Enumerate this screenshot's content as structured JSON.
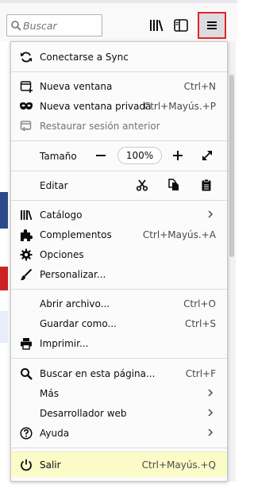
{
  "toolbar": {
    "search_placeholder": "Buscar",
    "icons": {
      "search": "search-icon",
      "library": "library-icon",
      "sidebar": "sidebar-icon",
      "menu": "hamburger-menu-icon"
    },
    "menu_button_highlight_color": "#e2242b"
  },
  "menu": {
    "sync": {
      "label": "Conectarse a Sync",
      "icon": "sync-icon"
    },
    "new_window": {
      "label": "Nueva ventana",
      "shortcut": "Ctrl+N",
      "icon": "new-window-icon"
    },
    "new_private_window": {
      "label": "Nueva ventana privada",
      "shortcut": "Ctrl+Mayús.+P",
      "icon": "private-mask-icon"
    },
    "restore_session": {
      "label": "Restaurar sesión anterior",
      "icon": "restore-session-icon"
    },
    "zoom": {
      "label": "Tamaño",
      "value": "100%"
    },
    "edit": {
      "label": "Editar",
      "icons": [
        "cut-icon",
        "copy-icon",
        "paste-icon"
      ]
    },
    "library": {
      "label": "Catálogo",
      "icon": "library-icon"
    },
    "addons": {
      "label": "Complementos",
      "shortcut": "Ctrl+Mayús.+A",
      "icon": "puzzle-icon"
    },
    "options": {
      "label": "Opciones",
      "icon": "gear-icon"
    },
    "customize": {
      "label": "Personalizar...",
      "icon": "paintbrush-icon"
    },
    "open_file": {
      "label": "Abrir archivo...",
      "shortcut": "Ctrl+O"
    },
    "save_as": {
      "label": "Guardar como...",
      "shortcut": "Ctrl+S"
    },
    "print": {
      "label": "Imprimir...",
      "icon": "printer-icon"
    },
    "find": {
      "label": "Buscar en esta página...",
      "shortcut": "Ctrl+F",
      "icon": "search-icon"
    },
    "more": {
      "label": "Más"
    },
    "web_developer": {
      "label": "Desarrollador web"
    },
    "help": {
      "label": "Ayuda",
      "icon": "help-icon"
    },
    "quit": {
      "label": "Salir",
      "shortcut": "Ctrl+Mayús.+Q",
      "icon": "power-icon",
      "highlight_color": "#fbfbc7"
    }
  }
}
